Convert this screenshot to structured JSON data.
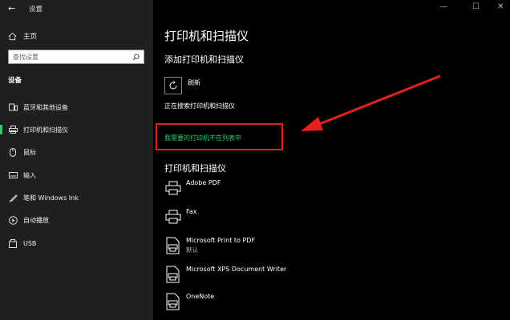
{
  "window": {
    "title": "设置",
    "back": "←",
    "minimize": "—",
    "maximize": "☐",
    "close": "✕"
  },
  "sidebar": {
    "home": "主页",
    "search_placeholder": "查找设置",
    "section": "设备",
    "items": [
      {
        "label": "蓝牙和其他设备",
        "icon": "bluetooth-devices-icon"
      },
      {
        "label": "打印机和扫描仪",
        "icon": "printer-icon",
        "active": true
      },
      {
        "label": "鼠标",
        "icon": "mouse-icon"
      },
      {
        "label": "输入",
        "icon": "keyboard-icon"
      },
      {
        "label": "笔和 Windows Ink",
        "icon": "pen-icon"
      },
      {
        "label": "自动播放",
        "icon": "autoplay-icon"
      },
      {
        "label": "USB",
        "icon": "usb-icon"
      }
    ]
  },
  "main": {
    "title": "打印机和扫描仪",
    "add_section": "添加打印机和扫描仪",
    "refresh_label": "刷新",
    "status": "正在搜索打印机和扫描仪",
    "missing_link": "我需要的打印机不在列表中",
    "printers_section": "打印机和扫描仪",
    "printers": [
      {
        "name": "Adobe PDF",
        "sub": "",
        "icon": "printer-icon"
      },
      {
        "name": "Fax",
        "sub": "",
        "icon": "printer-icon"
      },
      {
        "name": "Microsoft Print to PDF",
        "sub": "默认",
        "icon": "document-printer-icon"
      },
      {
        "name": "Microsoft XPS Document Writer",
        "sub": "",
        "icon": "document-printer-icon"
      },
      {
        "name": "OneNote",
        "sub": "",
        "icon": "document-printer-icon"
      }
    ]
  },
  "colors": {
    "accent": "#2ecc71",
    "annotation": "#e5201f",
    "sidebar_bg": "#1f1f1f",
    "main_bg": "#000000"
  }
}
